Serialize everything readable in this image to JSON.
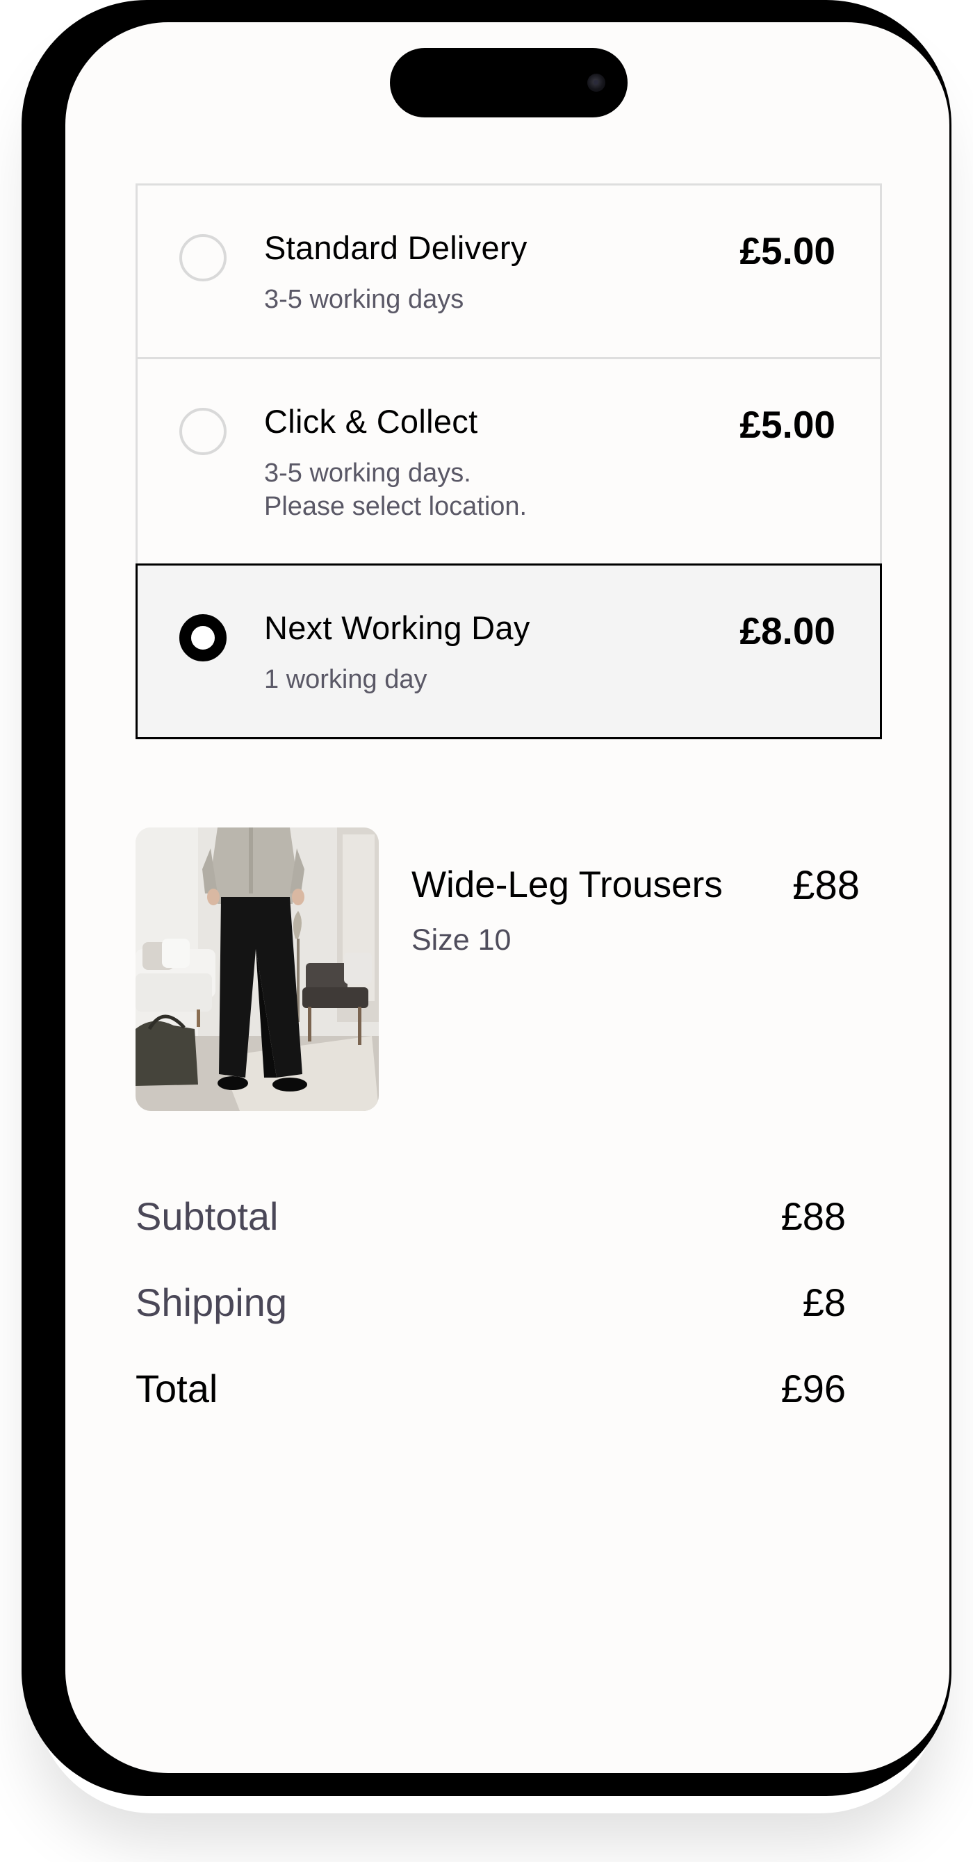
{
  "delivery": {
    "options": [
      {
        "title": "Standard Delivery",
        "subtitle": [
          "3-5 working days"
        ],
        "price": "£5.00",
        "selected": false
      },
      {
        "title": "Click & Collect",
        "subtitle": [
          "3-5 working days.",
          "Please select location."
        ],
        "price": "£5.00",
        "selected": false
      },
      {
        "title": "Next Working Day",
        "subtitle": [
          "1 working day"
        ],
        "price": "£8.00",
        "selected": true
      }
    ]
  },
  "product": {
    "name": "Wide-Leg Trousers",
    "size": "Size 10",
    "price": "£88"
  },
  "summary": {
    "subtotal_label": "Subtotal",
    "subtotal_value": "£88",
    "shipping_label": "Shipping",
    "shipping_value": "£8",
    "total_label": "Total",
    "total_value": "£96"
  },
  "colors": {
    "selected_border": "#000000",
    "selected_background": "#f4f4f4",
    "muted_text": "#5a5866",
    "screen_background": "#fdfcfb"
  },
  "icons": {
    "radio_unselected": "radio-empty-icon",
    "radio_selected": "radio-filled-icon"
  }
}
